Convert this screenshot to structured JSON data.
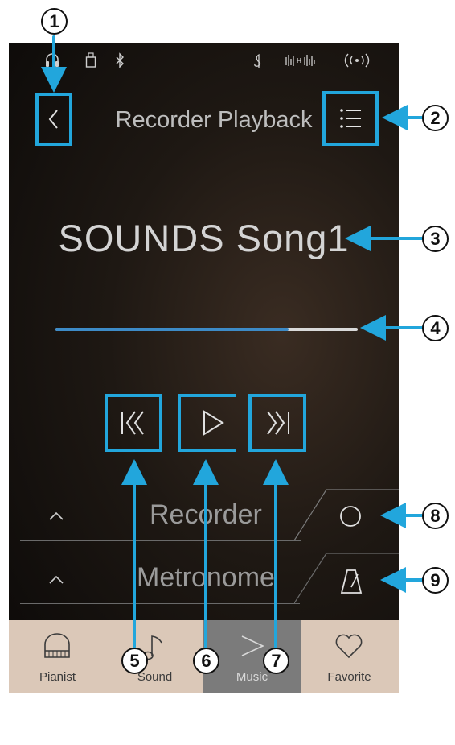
{
  "header": {
    "title": "Recorder Playback"
  },
  "status_icons": [
    "headphones-icon",
    "usb-icon",
    "bluetooth-icon",
    "clef-icon",
    "waveform-icon",
    "wireless-icon"
  ],
  "song": {
    "title": "SOUNDS Song1"
  },
  "playback": {
    "progress": 0.77
  },
  "panels": {
    "recorder_label": "Recorder",
    "metronome_label": "Metronome"
  },
  "nav": {
    "items": [
      {
        "label": "Pianist",
        "icon": "piano-icon"
      },
      {
        "label": "Sound",
        "icon": "music-note-icon"
      },
      {
        "label": "Music",
        "icon": "play-icon",
        "active": true
      },
      {
        "label": "Favorite",
        "icon": "heart-icon"
      }
    ]
  },
  "callouts": [
    "1",
    "2",
    "3",
    "4",
    "5",
    "6",
    "7",
    "8",
    "9"
  ],
  "colors": {
    "highlight": "#22a6dc",
    "progress": "#3d8bc7",
    "nav_bg": "#dbc8b8",
    "nav_active": "#7b7b7b"
  }
}
